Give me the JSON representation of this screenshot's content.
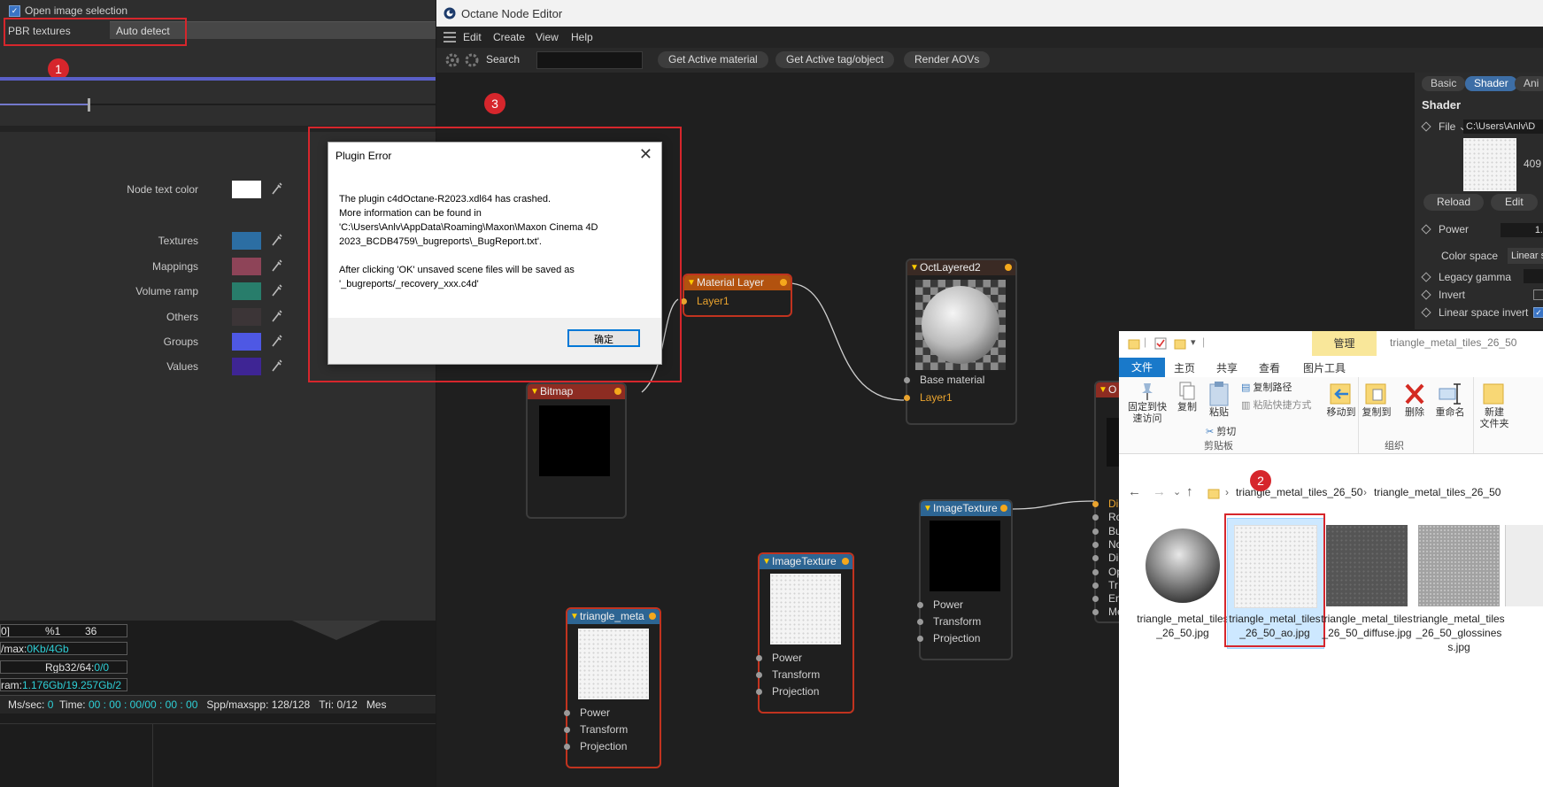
{
  "left_panel": {
    "open_image_selection": "Open image selection",
    "pbr_label": "PBR textures",
    "pbr_value": "Auto detect",
    "node_text_color_label": "Node text color",
    "colors": [
      {
        "label": "Textures",
        "color": "#2c6ea3"
      },
      {
        "label": "Mappings",
        "color": "#8e4458"
      },
      {
        "label": "Volume ramp",
        "color": "#287d6b"
      },
      {
        "label": "Others",
        "color": "#3c3537"
      },
      {
        "label": "Groups",
        "color": "#4e58e4"
      },
      {
        "label": "Values",
        "color": "#3e2594"
      }
    ],
    "stats": {
      "row1_a": "0]",
      "row1_b": "%1",
      "row1_c": "36",
      "row2_prefix": "/max:",
      "row2_value": "0Kb/4Gb",
      "row3_prefix": "Rgb32/64:",
      "row3_value": "0/0",
      "row4_prefix": "ram:",
      "row4_value": "1.176Gb/19.257Gb/2"
    },
    "status": {
      "ms_label": "Ms/sec:",
      "ms_value": "0",
      "time_label": "Time:",
      "time_value": "00 : 00 : 00/00 : 00 : 00",
      "spp_label": "Spp/maxspp:",
      "spp_value": "128/128",
      "tri_label": "Tri:",
      "tri_value": "0/12",
      "mes_label": "Mes"
    }
  },
  "node_editor": {
    "title": "Octane Node Editor",
    "menu": [
      "Edit",
      "Create",
      "View",
      "Help"
    ],
    "search_label": "Search",
    "toolbar_buttons": [
      "Get Active material",
      "Get Active tag/object",
      "Render AOVs"
    ],
    "nodes": {
      "material_layer": {
        "title": "Material Layer",
        "pins": [
          "Layer1"
        ]
      },
      "octlayered": {
        "title": "OctLayered2",
        "pins": [
          "Base material",
          "Layer1"
        ]
      },
      "bitmap": {
        "title": "Bitmap"
      },
      "image_texture_1": {
        "title": "ImageTexture",
        "pins": [
          "Power",
          "Transform",
          "Projection"
        ]
      },
      "image_texture_2": {
        "title": "ImageTexture",
        "pins": [
          "Power",
          "Transform",
          "Projection"
        ]
      },
      "triangle": {
        "title": "triangle_meta",
        "pins": [
          "Power",
          "Transform",
          "Projection"
        ]
      },
      "partial": {
        "title": "O",
        "pins": [
          "Di",
          "Ro",
          "Bu",
          "No",
          "Di",
          "Op",
          "Tr",
          "En",
          "Me"
        ]
      }
    },
    "sidebar": {
      "tabs": [
        "Basic",
        "Shader",
        "Ani"
      ],
      "heading": "Shader",
      "file_label": "File",
      "file_path": "C:\\Users\\Anlv\\D",
      "size_text": "409",
      "reload": "Reload",
      "edit": "Edit",
      "power_label": "Power",
      "power_value": "1.",
      "colorspace_label": "Color space",
      "colorspace_value": "Linear s",
      "legacy_gamma": "Legacy gamma",
      "invert": "Invert",
      "linear_space_invert": "Linear space invert"
    }
  },
  "dialog": {
    "title": "Plugin Error",
    "close": "✕",
    "message": "The plugin c4dOctane-R2023.xdl64 has crashed.\nMore information can be found in\n'C:\\Users\\Anlv\\AppData\\Roaming\\Maxon\\Maxon Cinema 4D\n2023_BCDB4759\\_bugreports\\_BugReport.txt'.\n\nAfter clicking 'OK' unsaved scene files will be saved as\n'_bugreports/_recovery_xxx.c4d'",
    "ok": "确定"
  },
  "badges": [
    "1",
    "2",
    "3"
  ],
  "explorer": {
    "manage": "管理",
    "title": "triangle_metal_tiles_26_50",
    "tabs": [
      "文件",
      "主页",
      "共享",
      "查看",
      "图片工具"
    ],
    "ribbon": {
      "pin_quick": "固定到快\n速访问",
      "copy": "复制",
      "paste": "粘贴",
      "copy_path": "复制路径",
      "paste_shortcut": "粘贴快捷方式",
      "cut": "剪切",
      "clipboard_group": "剪贴板",
      "move_to": "移动到",
      "copy_to": "复制到",
      "delete": "删除",
      "rename": "重命名",
      "organize_group": "组织",
      "new": "新建\n文件夹"
    },
    "breadcrumb": [
      "triangle_metal_tiles_26_50",
      "triangle_metal_tiles_26_50"
    ],
    "files": [
      {
        "name": "triangle_metal_tiles_26_50.jpg",
        "kind": "sphere"
      },
      {
        "name": "triangle_metal_tiles_26_50_ao.jpg",
        "kind": "white"
      },
      {
        "name": "triangle_metal_tiles_26_50_diffuse.jpg",
        "kind": "dark"
      },
      {
        "name": "triangle_metal_tiles_26_50_glossiness.jpg",
        "kind": "grey"
      }
    ]
  }
}
